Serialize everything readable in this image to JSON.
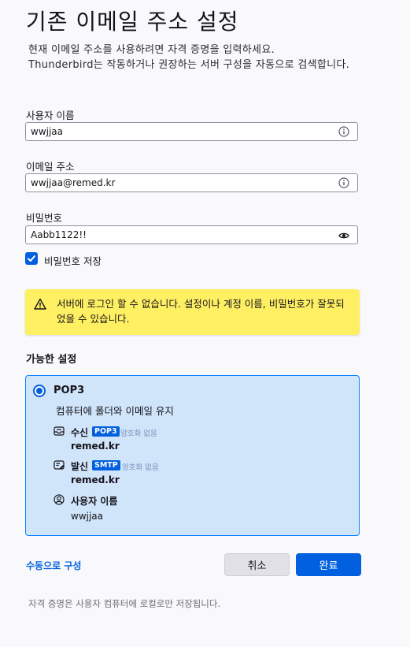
{
  "page": {
    "title": "기존 이메일 주소 설정",
    "desc_line1": "현재 이메일 주소를 사용하려면 자격 증명을 입력하세요.",
    "desc_line2": "Thunderbird는 작동하거나 권장하는 서버 구성을 자동으로 검색합니다."
  },
  "form": {
    "username_label": "사용자 이름",
    "username_value": "wwjjaa",
    "email_label": "이메일 주소",
    "email_value": "wwjjaa@remed.kr",
    "password_label": "비밀번호",
    "password_value": "Aabb1122!!",
    "remember_password_label": "비밀번호 저장",
    "remember_password_checked": true
  },
  "warning": {
    "text": "서버에 로그인 할 수 없습니다. 설정이나 계정 이름, 비밀번호가 잘못되었을 수 있습니다."
  },
  "settings": {
    "section_title": "가능한 설정",
    "option": {
      "title": "POP3",
      "subtitle": "컴퓨터에 폴더와 이메일 유지",
      "incoming_label": "수신",
      "incoming_badge": "POP3",
      "incoming_encryption": "암호화 없음",
      "incoming_server": "remed.kr",
      "outgoing_label": "발신",
      "outgoing_badge": "SMTP",
      "outgoing_encryption": "암호화 없음",
      "outgoing_server": "remed.kr",
      "user_label": "사용자 이름",
      "user_value": "wwjjaa"
    }
  },
  "actions": {
    "manual_config": "수동으로 구성",
    "cancel": "취소",
    "done": "완료"
  },
  "footer": {
    "note": "자격 증명은 사용자 컴퓨터에 로컬로만 저장됩니다."
  },
  "colors": {
    "accent": "#0060df",
    "warning_bg": "#fff063",
    "card_bg": "#d0e4fa"
  }
}
